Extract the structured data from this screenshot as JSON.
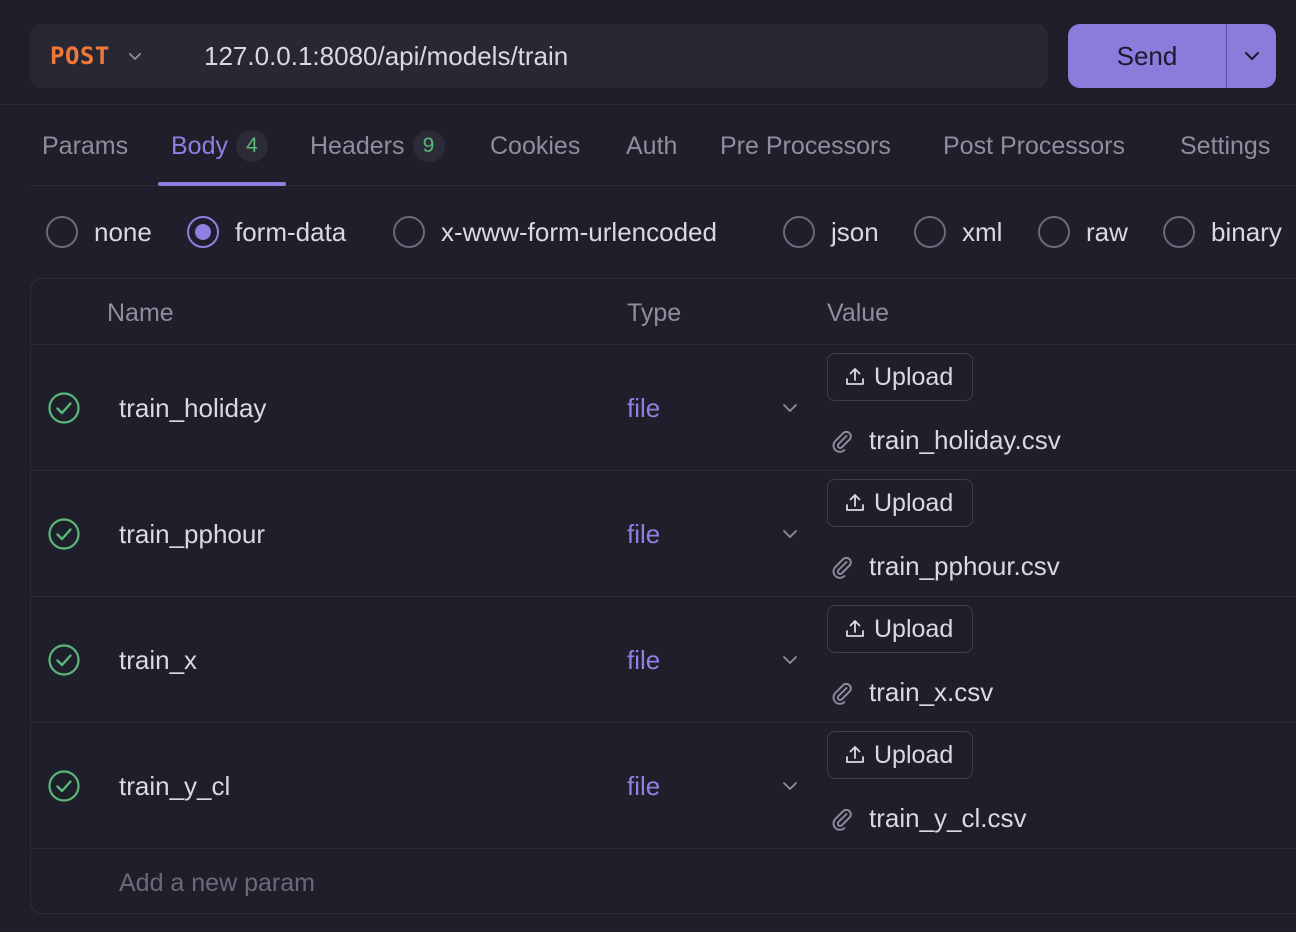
{
  "request": {
    "method": "POST",
    "url": "127.0.0.1:8080/api/models/train",
    "send_label": "Send"
  },
  "tabs": [
    {
      "label": "Params"
    },
    {
      "label": "Body",
      "badge": "4",
      "active": true
    },
    {
      "label": "Headers",
      "badge": "9"
    },
    {
      "label": "Cookies"
    },
    {
      "label": "Auth"
    },
    {
      "label": "Pre Processors"
    },
    {
      "label": "Post Processors"
    },
    {
      "label": "Settings"
    }
  ],
  "body_types": [
    {
      "label": "none",
      "checked": false
    },
    {
      "label": "form-data",
      "checked": true
    },
    {
      "label": "x-www-form-urlencoded",
      "checked": false
    },
    {
      "label": "json",
      "checked": false
    },
    {
      "label": "xml",
      "checked": false
    },
    {
      "label": "raw",
      "checked": false
    },
    {
      "label": "binary",
      "checked": false
    }
  ],
  "table": {
    "headers": {
      "name": "Name",
      "type": "Type",
      "value": "Value"
    },
    "rows": [
      {
        "name": "train_holiday",
        "type": "file",
        "upload_label": "Upload",
        "filename": "train_holiday.csv"
      },
      {
        "name": "train_pphour",
        "type": "file",
        "upload_label": "Upload",
        "filename": "train_pphour.csv"
      },
      {
        "name": "train_x",
        "type": "file",
        "upload_label": "Upload",
        "filename": "train_x.csv"
      },
      {
        "name": "train_y_cl",
        "type": "file",
        "upload_label": "Upload",
        "filename": "train_y_cl.csv"
      }
    ],
    "add_placeholder": "Add a new param"
  },
  "colors": {
    "background": "#1f1f2b",
    "accent": "#8f7fe0",
    "method": "#f0793a",
    "badge_text": "#5ab87a",
    "check": "#5ab87a"
  }
}
